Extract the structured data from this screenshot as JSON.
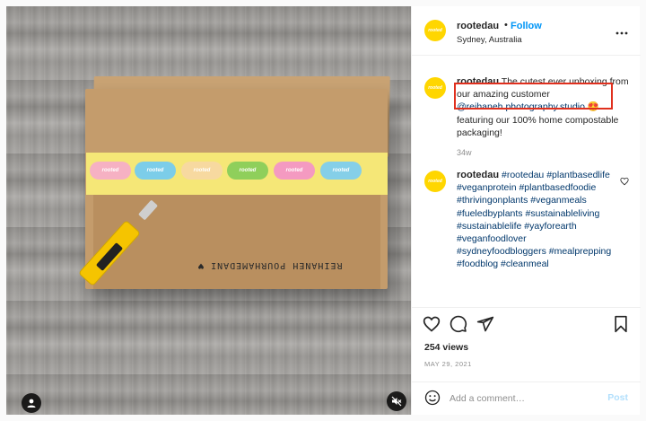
{
  "header": {
    "avatar_text": "rooted",
    "username": "rootedau",
    "separator": "•",
    "follow_label": "Follow",
    "location": "Sydney, Australia",
    "more_icon": "more-horizontal-icon"
  },
  "media": {
    "sticker_text": "rooted",
    "handwriting": "REIHANEH POURHAMEDANI ♥",
    "user_tag_icon": "user-icon",
    "mute_icon": "volume-muted-icon"
  },
  "caption": {
    "username": "rootedau",
    "text_before": " The cutest ever unboxing from our amazing customer ",
    "mention": "@reihaneh.photography.studio",
    "emoji": " 😍",
    "text_after": " featuring our 100% home compostable packaging!",
    "time": "34w"
  },
  "comment": {
    "username": "rootedau",
    "hashtags": "#rootedau #plantbasedlife #veganprotein #plantbasedfoodie #thrivingonplants #veganmeals #fueledbyplants #sustainableliving #sustainablelife #yayforearth #veganfoodlover #sydneyfoodbloggers #mealprepping #foodblog #cleanmeal"
  },
  "actions": {
    "like_icon": "heart-icon",
    "comment_icon": "comment-bubble-icon",
    "share_icon": "paper-plane-icon",
    "save_icon": "bookmark-icon",
    "views": "254 views",
    "date": "MAY 29, 2021"
  },
  "comment_bar": {
    "emoji_icon": "smiley-icon",
    "placeholder": "Add a comment…",
    "post_label": "Post"
  },
  "colors": {
    "accent": "#0095f6",
    "avatar": "#ffd600",
    "highlight": "#e0301e",
    "post_disabled": "#b2dffc"
  }
}
